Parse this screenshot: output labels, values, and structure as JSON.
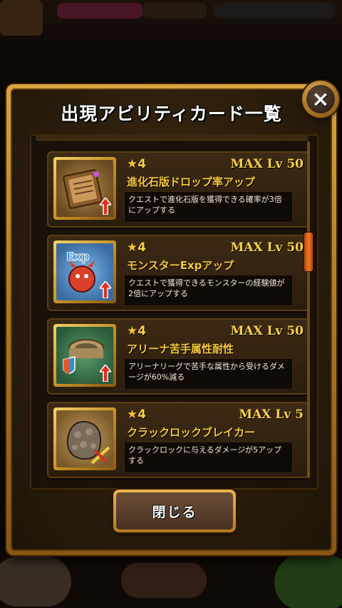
{
  "modal": {
    "title": "出現アビリティカード一覧",
    "close_icon": "×",
    "close_button_label": "閉じる"
  },
  "cards": [
    {
      "stars": "4",
      "max_level": "MAX Lv 50",
      "name": "進化石版ドロップ率アップ",
      "description": "クエストで進化石版を獲得できる確率が3倍にアップする",
      "icon": "tablet-icon"
    },
    {
      "stars": "4",
      "max_level": "MAX Lv 50",
      "name": "モンスターExpアップ",
      "description": "クエストで獲得できるモンスターの経験値が2倍にアップする",
      "icon": "monster-exp-icon"
    },
    {
      "stars": "4",
      "max_level": "MAX Lv 50",
      "name": "アリーナ苦手属性耐性",
      "description": "アリーナリーグで苦手な属性から受けるダメージが60%減る",
      "icon": "arena-shield-icon"
    },
    {
      "stars": "4",
      "max_level": "MAX Lv 5",
      "name": "クラックロックブレイカー",
      "description": "クラックロックに与えるダメージが5アップする",
      "icon": "crack-rock-icon"
    }
  ],
  "colors": {
    "frame_gold": "#d9a43f",
    "text_gold": "#f6d04b",
    "scroll_thumb": "#f07a20"
  }
}
